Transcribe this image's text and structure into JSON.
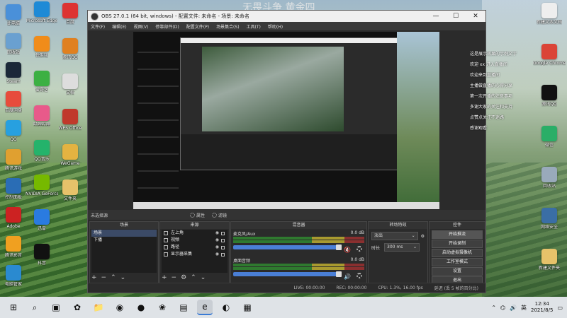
{
  "overlay": {
    "title": "无畏斗争 黄金四"
  },
  "desktop_icons_left": [
    {
      "label": "此电脑",
      "color": "#4a90d9"
    },
    {
      "label": "回收站",
      "color": "#6aa0d0"
    },
    {
      "label": "Steam",
      "color": "#1b2838"
    },
    {
      "label": "百度网盘",
      "color": "#e74c3c"
    },
    {
      "label": "QQ",
      "color": "#27a0e0"
    },
    {
      "label": "腾讯游戏",
      "color": "#e0a030"
    },
    {
      "label": "控制面板",
      "color": "#2a6db5"
    },
    {
      "label": "Adobe",
      "color": "#cc2222"
    },
    {
      "label": "腾讯影音",
      "color": "#f0a020"
    },
    {
      "label": "电脑管家",
      "color": "#2a8ad0"
    }
  ],
  "desktop_icons_col2": [
    {
      "label": "Microsoft Edge",
      "color": "#1e8ad6"
    },
    {
      "label": "快剪辑",
      "color": "#f08c1a"
    },
    {
      "label": "爱奇艺",
      "color": "#3cb043"
    },
    {
      "label": "哔哩哔哩",
      "color": "#e85a8a"
    },
    {
      "label": "QQ音乐",
      "color": "#24b36b"
    },
    {
      "label": "NVIDIA GeForce Experience",
      "color": "#76b900"
    },
    {
      "label": "迅雷",
      "color": "#2a7be0"
    },
    {
      "label": "抖音",
      "color": "#111"
    }
  ],
  "desktop_icons_col3": [
    {
      "label": "百度",
      "color": "#d33"
    },
    {
      "label": "腾讯QQ",
      "color": "#e08020"
    },
    {
      "label": "文档",
      "color": "#ddd"
    },
    {
      "label": "WPS Office",
      "color": "#c0392b"
    },
    {
      "label": "WeGame",
      "color": "#e3b341"
    },
    {
      "label": "文件夹",
      "color": "#e6c26a"
    }
  ],
  "desktop_icons_right": [
    {
      "label": "新建文本文档",
      "color": "#eee"
    },
    {
      "label": "Google Chrome",
      "color": "#db4437"
    },
    {
      "label": "腾讯QQ",
      "color": "#111"
    },
    {
      "label": "微信",
      "color": "#2aae67"
    },
    {
      "label": "回收站",
      "color": "#9ab"
    },
    {
      "label": "网络安全",
      "color": "#3a6ea5"
    },
    {
      "label": "新建文件夹",
      "color": "#e6c26a"
    }
  ],
  "obs": {
    "title": "OBS 27.0.1 (64 bit, windows) - 配置文件: 未命名 - 场景: 未命名",
    "menu": [
      "文件(F)",
      "编辑(E)",
      "视图(V)",
      "停靠部件(D)",
      "配置文件(P)",
      "场景集合(S)",
      "工具(T)",
      "帮助(H)"
    ],
    "no_source_selected": "未选择源",
    "properties_label": "属性",
    "filters_label": "滤镜",
    "docks": {
      "scenes": {
        "title": "场景",
        "items": [
          "场景",
          "下播"
        ]
      },
      "sources": {
        "title": "来源",
        "items": [
          "左上角",
          "视频",
          "路径",
          "显示器采集"
        ]
      },
      "mixer": {
        "title": "混音器",
        "channels": [
          {
            "name": "麦克风/Aux",
            "db": "0.0 dB",
            "level": 0.6
          },
          {
            "name": "桌面音频",
            "db": "0.0 dB",
            "level": 0.6
          }
        ]
      },
      "transitions": {
        "title": "转场特效",
        "type": "淡出",
        "duration_label": "时长",
        "duration": "300 ms"
      },
      "controls": {
        "title": "控件",
        "buttons": [
          "开始推流",
          "开始录制",
          "启动虚拟摄像机",
          "工作室模式",
          "设置",
          "退出"
        ]
      }
    },
    "status": {
      "live": "LIVE: 00:00:00",
      "rec": "REC: 00:00:00",
      "cpu": "CPU: 1.3%, 16.00 fps",
      "dropped": "延迟 (丢 5 帧的百分比)"
    }
  },
  "chat": [
    "这是展示效果的示例文字",
    "欢迎 xx 进入直播间",
    "欢迎来到直播间",
    "主播做直播的心得分享",
    "第一次开播的注意事项",
    "多谢大家的关注和支持",
    "点赞点关注不迷路",
    "感谢观看"
  ],
  "taskbar": {
    "icons": [
      "⊞",
      "⌕",
      "▣",
      "✿",
      "📁",
      "◉",
      "●",
      "❀",
      "▤",
      "e",
      "◐",
      "▦"
    ],
    "tray_lang": "英",
    "time": "12:34",
    "date": "2021/8/5"
  }
}
